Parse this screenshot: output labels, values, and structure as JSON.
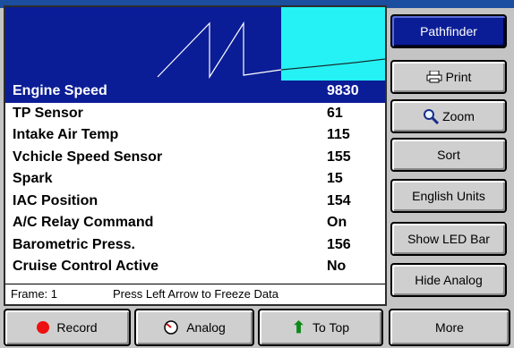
{
  "graph": {
    "colors": {
      "background": "#0b1d96",
      "recent": "#24f2f5",
      "trace": "#ffffff"
    }
  },
  "parameters": [
    {
      "label": "Engine Speed",
      "value": "9830",
      "selected": true
    },
    {
      "label": "TP Sensor",
      "value": "61"
    },
    {
      "label": "Intake Air Temp",
      "value": "115"
    },
    {
      "label": "Vchicle Speed Sensor",
      "value": "155"
    },
    {
      "label": "Spark",
      "value": "15"
    },
    {
      "label": "IAC Position",
      "value": "154"
    },
    {
      "label": "A/C Relay Command",
      "value": "On"
    },
    {
      "label": "Barometric Press.",
      "value": "156"
    },
    {
      "label": "Cruise Control Active",
      "value": "No"
    }
  ],
  "status": {
    "frame": "Frame: 1",
    "hint": "Press Left Arrow to Freeze Data"
  },
  "side_buttons": {
    "pathfinder": "Pathfinder",
    "print": "Print",
    "zoom": "Zoom",
    "sort": "Sort",
    "units": "English Units",
    "led": "Show LED Bar",
    "analog": "Hide Analog"
  },
  "bottom_buttons": {
    "record": "Record",
    "analog": "Analog",
    "top": "To Top",
    "more": "More"
  },
  "icons": {
    "print": "printer-icon",
    "zoom": "magnifier-icon",
    "record": "record-dot-icon",
    "analog": "gauge-icon",
    "top": "up-arrow-icon"
  }
}
